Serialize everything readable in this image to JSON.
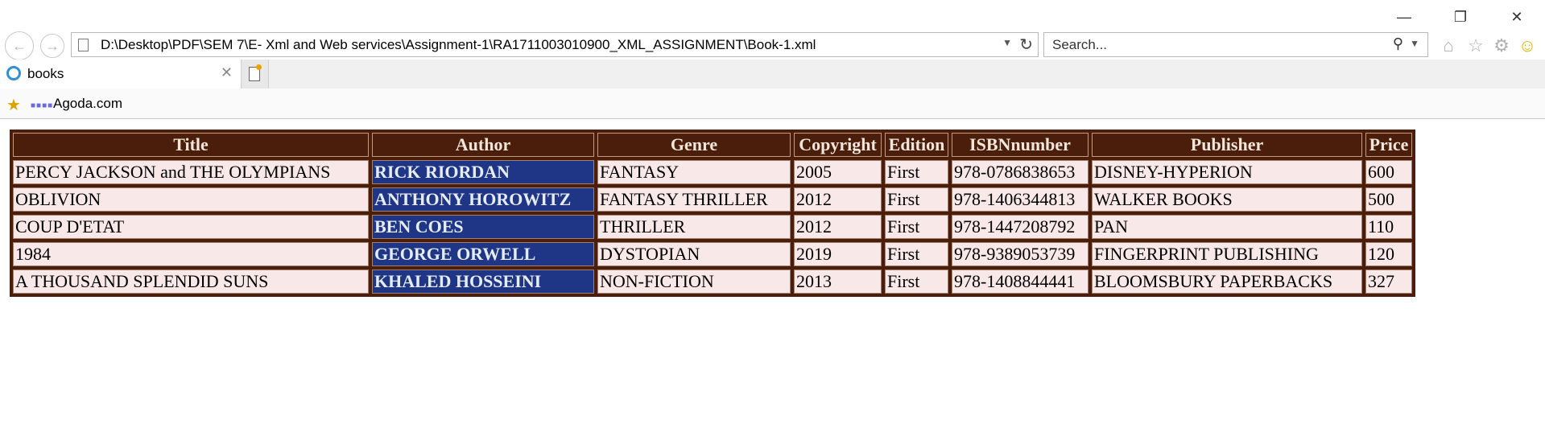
{
  "window": {
    "minimize_glyph": "—",
    "restore_glyph": "❐",
    "close_glyph": "✕"
  },
  "nav": {
    "address_url": "D:\\Desktop\\PDF\\SEM 7\\E- Xml and Web services\\Assignment-1\\RA1711003010900_XML_ASSIGNMENT\\Book-1.xml",
    "search_placeholder": "Search..."
  },
  "tabs": [
    {
      "label": "books",
      "active": true
    }
  ],
  "favorites": [
    {
      "label": "Agoda.com"
    }
  ],
  "table": {
    "headers": [
      "Title",
      "Author",
      "Genre",
      "Copyright",
      "Edition",
      "ISBNnumber",
      "Publisher",
      "Price"
    ],
    "rows": [
      [
        "PERCY JACKSON and THE OLYMPIANS",
        "RICK RIORDAN",
        "FANTASY",
        "2005",
        "First",
        "978-0786838653",
        "DISNEY-HYPERION",
        "600"
      ],
      [
        "OBLIVION",
        "ANTHONY HOROWITZ",
        "FANTASY THRILLER",
        "2012",
        "First",
        "978-1406344813",
        "WALKER BOOKS",
        "500"
      ],
      [
        "COUP D'ETAT",
        "BEN COES",
        "THRILLER",
        "2012",
        "First",
        "978-1447208792",
        "PAN",
        "110"
      ],
      [
        "1984",
        "GEORGE ORWELL",
        "DYSTOPIAN",
        "2019",
        "First",
        "978-9389053739",
        "FINGERPRINT PUBLISHING",
        "120"
      ],
      [
        "A THOUSAND SPLENDID SUNS",
        "KHALED HOSSEINI",
        "NON-FICTION",
        "2013",
        "First",
        "978-1408844441",
        "BLOOMSBURY PAPERBACKS",
        "327"
      ]
    ]
  },
  "colors": {
    "table_border": "#4a1e0a",
    "header_bg": "#4a1e0a",
    "cell_bg": "#f9e8e8",
    "author_bg": "#1f3586"
  }
}
